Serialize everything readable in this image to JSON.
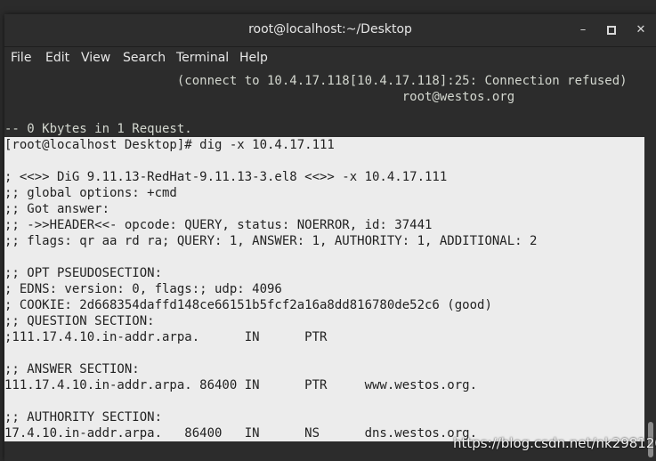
{
  "window": {
    "title": "root@localhost:~/Desktop",
    "buttons": {
      "minimize": "–",
      "close": "✕"
    }
  },
  "menu": [
    "File",
    "Edit",
    "View",
    "Search",
    "Terminal",
    "Help"
  ],
  "terminal_lines": [
    "                       (connect to 10.4.17.118[10.4.17.118]:25: Connection refused)",
    "                                                     root@westos.org",
    "",
    "-- 0 Kbytes in 1 Request.",
    "[root@localhost Desktop]# dig -x 10.4.17.111",
    "",
    "; <<>> DiG 9.11.13-RedHat-9.11.13-3.el8 <<>> -x 10.4.17.111",
    ";; global options: +cmd",
    ";; Got answer:",
    ";; ->>HEADER<<- opcode: QUERY, status: NOERROR, id: 37441",
    ";; flags: qr aa rd ra; QUERY: 1, ANSWER: 1, AUTHORITY: 1, ADDITIONAL: 2",
    "",
    ";; OPT PSEUDOSECTION:",
    "; EDNS: version: 0, flags:; udp: 4096",
    "; COOKIE: 2d668354daffd148ce66151b5fcf2a16a8dd816780de52c6 (good)",
    ";; QUESTION SECTION:",
    ";111.17.4.10.in-addr.arpa.      IN      PTR",
    "",
    ";; ANSWER SECTION:",
    "111.17.4.10.in-addr.arpa. 86400 IN      PTR     www.westos.org.",
    "",
    ";; AUTHORITY SECTION:",
    "17.4.10.in-addr.arpa.   86400   IN      NS      dns.westos.org."
  ],
  "selection_start_line": 4,
  "watermark": "https://blog.csdn.net/nk298120",
  "colors": {
    "terminal_bg": "#2c2c2c",
    "terminal_fg": "#d3d7cf",
    "selection_bg": "#ececec",
    "selection_fg": "#222222"
  }
}
